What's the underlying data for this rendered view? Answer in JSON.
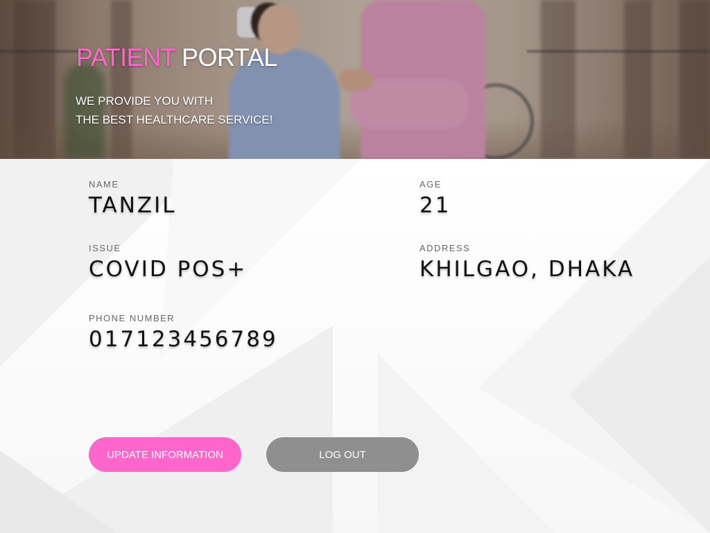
{
  "header": {
    "title_accent": "PATIENT",
    "title_rest": "PORTAL",
    "tagline_line1": "WE PROVIDE YOU WITH",
    "tagline_line2": "THE BEST HEALTHCARE SERVICE!"
  },
  "patient": {
    "name": {
      "label": "NAME",
      "value": "TANZIL"
    },
    "age": {
      "label": "AGE",
      "value": "21"
    },
    "issue": {
      "label": "ISSUE",
      "value": "COVID POS+"
    },
    "address": {
      "label": "ADDRESS",
      "value": "KHILGAO, DHAKA"
    },
    "phone": {
      "label": "PHONE NUMBER",
      "value": "017123456789"
    }
  },
  "actions": {
    "update_label": "UPDATE INFORMATION",
    "logout_label": "LOG OUT"
  },
  "colors": {
    "accent": "#ff66cc",
    "secondary_button": "#8f8f8f",
    "text": "#111111",
    "label": "#666666"
  }
}
